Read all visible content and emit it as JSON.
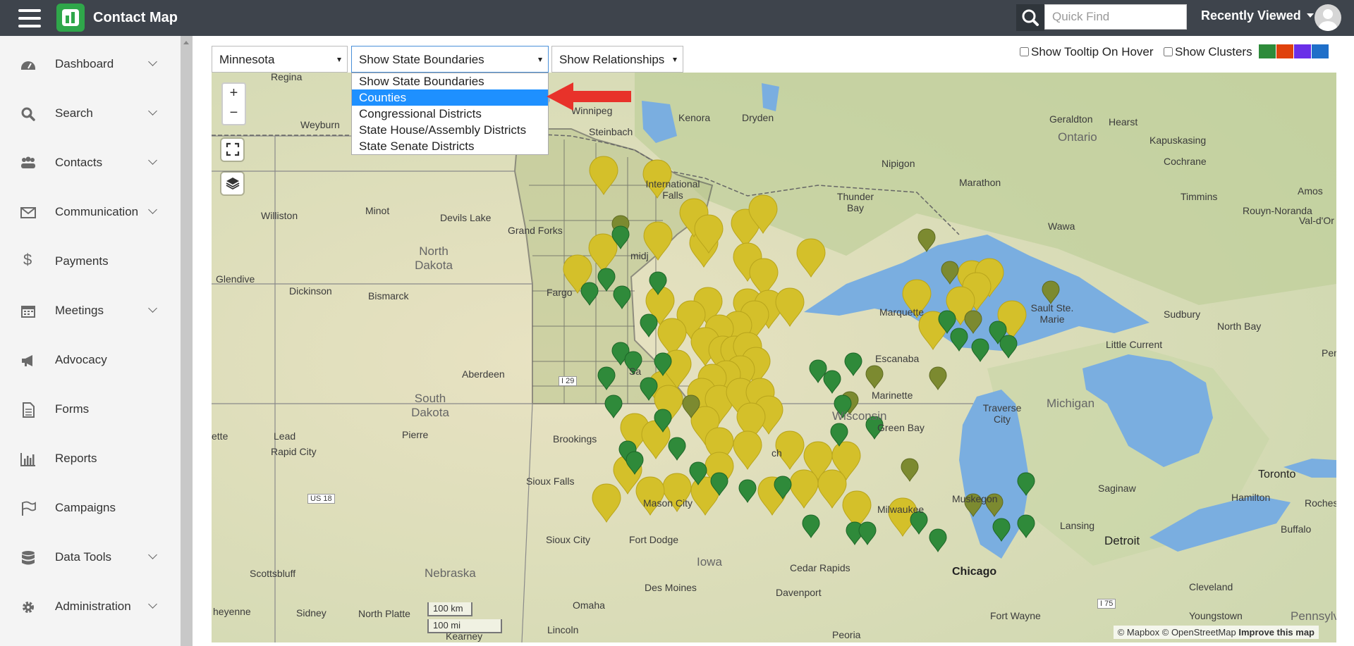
{
  "app": {
    "title": "Contact Map"
  },
  "header": {
    "quick_find_placeholder": "Quick Find",
    "recently_viewed": "Recently Viewed"
  },
  "sidebar": {
    "items": [
      {
        "label": "Dashboard",
        "icon": "dashboard-icon",
        "expandable": true
      },
      {
        "label": "Search",
        "icon": "search-icon",
        "expandable": true
      },
      {
        "label": "Contacts",
        "icon": "contacts-icon",
        "expandable": true
      },
      {
        "label": "Communication",
        "icon": "envelope-icon",
        "expandable": true
      },
      {
        "label": "Payments",
        "icon": "dollar-icon",
        "expandable": false
      },
      {
        "label": "Meetings",
        "icon": "calendar-icon",
        "expandable": true
      },
      {
        "label": "Advocacy",
        "icon": "megaphone-icon",
        "expandable": false
      },
      {
        "label": "Forms",
        "icon": "file-icon",
        "expandable": false
      },
      {
        "label": "Reports",
        "icon": "bar-chart-icon",
        "expandable": false
      },
      {
        "label": "Campaigns",
        "icon": "flag-icon",
        "expandable": false
      },
      {
        "label": "Data Tools",
        "icon": "database-icon",
        "expandable": true
      },
      {
        "label": "Administration",
        "icon": "gear-icon",
        "expandable": true
      }
    ]
  },
  "filters": {
    "state": "Minnesota",
    "boundaries": "Show State Boundaries",
    "relationships": "Show Relationships",
    "boundary_options": [
      "Show State Boundaries",
      "Counties",
      "Congressional Districts",
      "State House/Assembly Districts",
      "State Senate Districts"
    ],
    "highlighted_option": "Counties"
  },
  "options": {
    "tooltip_label": "Show Tooltip On Hover",
    "clusters_label": "Show Clusters",
    "color_swatches": [
      "#2e8b3a",
      "#e0410c",
      "#6a2fe8",
      "#1f6fc9"
    ]
  },
  "map": {
    "zoom_in": "+",
    "zoom_out": "−",
    "scale_km": "100 km",
    "scale_mi": "100 mi",
    "attribution_1": "© Mapbox © OpenStreetMap",
    "attribution_2": "Improve this map",
    "place_labels": {
      "regina": "Regina",
      "weyburn": "Weyburn",
      "minot": "Minot",
      "williston": "Williston",
      "devils_lake": "Devils Lake",
      "grand_forks": "Grand Forks",
      "north_dakota": "North Dakota",
      "glendive": "Glendive",
      "dickinson": "Dickinson",
      "bismarck": "Bismarck",
      "fargo": "Fargo",
      "aberdeen": "Aberdeen",
      "south_dakota": "South Dakota",
      "pierre": "Pierre",
      "lead": "Lead",
      "rapid_city": "Rapid City",
      "brookings": "Brookings",
      "sioux_falls": "Sioux Falls",
      "scottsbluff": "Scottsbluff",
      "nebraska": "Nebraska",
      "sioux_city": "Sioux City",
      "sidney": "Sidney",
      "north_platte": "North Platte",
      "omaha": "Omaha",
      "lincoln": "Lincoln",
      "kearney": "Kearney",
      "fort_dodge": "Fort Dodge",
      "iowa": "Iowa",
      "des_moines": "Des Moines",
      "mason_city": "Mason City",
      "cedar_rapids": "Cedar Rapids",
      "davenport": "Davenport",
      "peoria": "Peoria",
      "winnipeg": "Winnipeg",
      "steinbach": "Steinbach",
      "kenora": "Kenora",
      "dryden": "Dryden",
      "international_falls": "International Falls",
      "thunder_bay": "Thunder Bay",
      "nipigon": "Nipigon",
      "marathon": "Marathon",
      "geraldton": "Geraldton",
      "hearst": "Hearst",
      "ontario": "Ontario",
      "kapuskasing": "Kapuskasing",
      "cochrane": "Cochrane",
      "timmins": "Timmins",
      "amos": "Amos",
      "rouyn_noranda": "Rouyn-Noranda",
      "val_dor": "Val-d'Or",
      "wawa": "Wawa",
      "marquette": "Marquette",
      "sault_ste_marie": "Sault Ste. Marie",
      "sudbury": "Sudbury",
      "north_bay": "North Bay",
      "escanaba": "Escanaba",
      "little_current": "Little Current",
      "wisconsin": "Wisconsin",
      "marinette": "Marinette",
      "green_bay": "Green Bay",
      "traverse_city": "Traverse City",
      "michigan": "Michigan",
      "saginaw": "Saginaw",
      "muskegon": "Muskegon",
      "lansing": "Lansing",
      "milwaukee": "Milwaukee",
      "chicago": "Chicago",
      "detroit": "Detroit",
      "toronto": "Toronto",
      "hamilton": "Hamilton",
      "rochester": "Rochester",
      "buffalo": "Buffalo",
      "cleveland": "Cleveland",
      "youngstown": "Youngstown",
      "fort_wayne": "Fort Wayne",
      "pennsylvania": "Pennsylv",
      "pem": "Pem",
      "i29": "I 29",
      "us18": "US 18",
      "i75": "I 75",
      "cheyenne": "heyenne",
      "ette": "ette",
      "sai": "Sa",
      "bemidji": "midj",
      "ch": "ch"
    }
  }
}
